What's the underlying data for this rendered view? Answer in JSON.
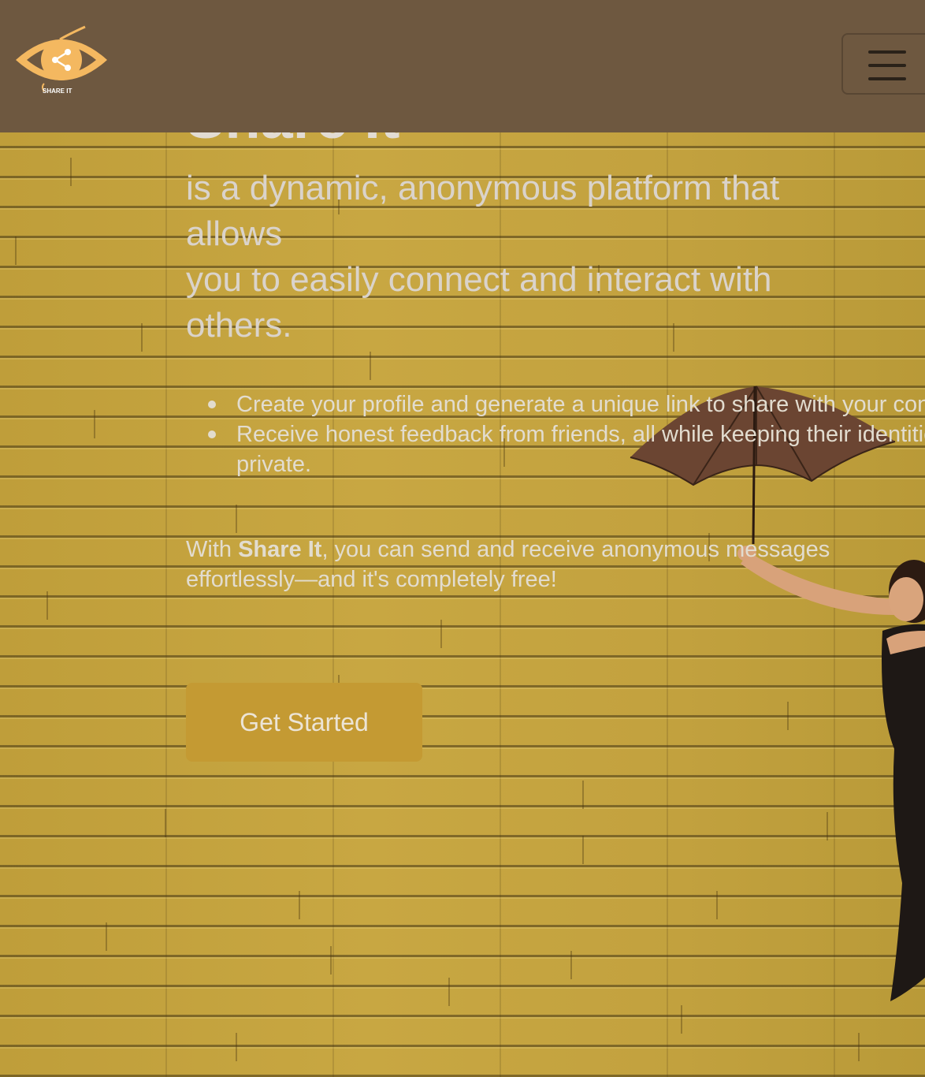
{
  "header": {
    "logo_text": "SHARE IT",
    "menu_label": ""
  },
  "hero": {
    "title": "Share It",
    "lead_lines": [
      "is a dynamic, anonymous platform that allows",
      "you to easily connect and interact with others."
    ],
    "features": [
      "Create your profile and generate a unique link to share with your contacts.",
      "Receive honest feedback from friends, all while keeping their identities private."
    ],
    "closing": {
      "prefix": "With ",
      "brand": "Share It",
      "suffix": ", you can send and receive anonymous messages effortlessly—and it's completely free!"
    },
    "cta_label": "Get Started"
  },
  "colors": {
    "header_bg": "#6e5840",
    "wall": "#c4a43f",
    "cta_bg": "#c49a33",
    "logo_orange": "#f4b860"
  }
}
